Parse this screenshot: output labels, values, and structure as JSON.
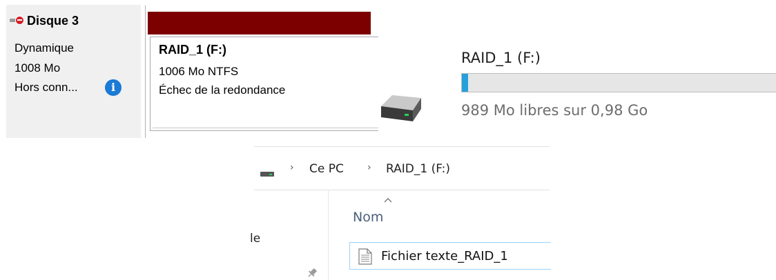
{
  "disk_management": {
    "disk": {
      "name": "Disque 3",
      "type": "Dynamique",
      "size": "1008 Mo",
      "status": "Hors conn...",
      "status_icon": "info-icon",
      "disk_icon": "disk-offline-error-icon"
    },
    "volume": {
      "title": "RAID_1  (F:)",
      "size_fs": "1006 Mo NTFS",
      "status": "Échec de la redondance",
      "header_color": "#7c0000"
    }
  },
  "drive_tile": {
    "icon": "hard-drive-icon",
    "name": "RAID_1 (F:)",
    "usage_fraction": 0.02,
    "free_text": "989 Mo libres sur 0,98 Go",
    "bar_color": "#26a0da"
  },
  "explorer": {
    "breadcrumb": [
      "Ce PC",
      "RAID_1 (F:)"
    ],
    "breadcrumb_icon": "drive-icon",
    "column_header": "Nom",
    "nav_fragment": "le",
    "files": [
      {
        "name": "Fichier texte_RAID_1",
        "icon": "text-file-icon"
      }
    ]
  }
}
